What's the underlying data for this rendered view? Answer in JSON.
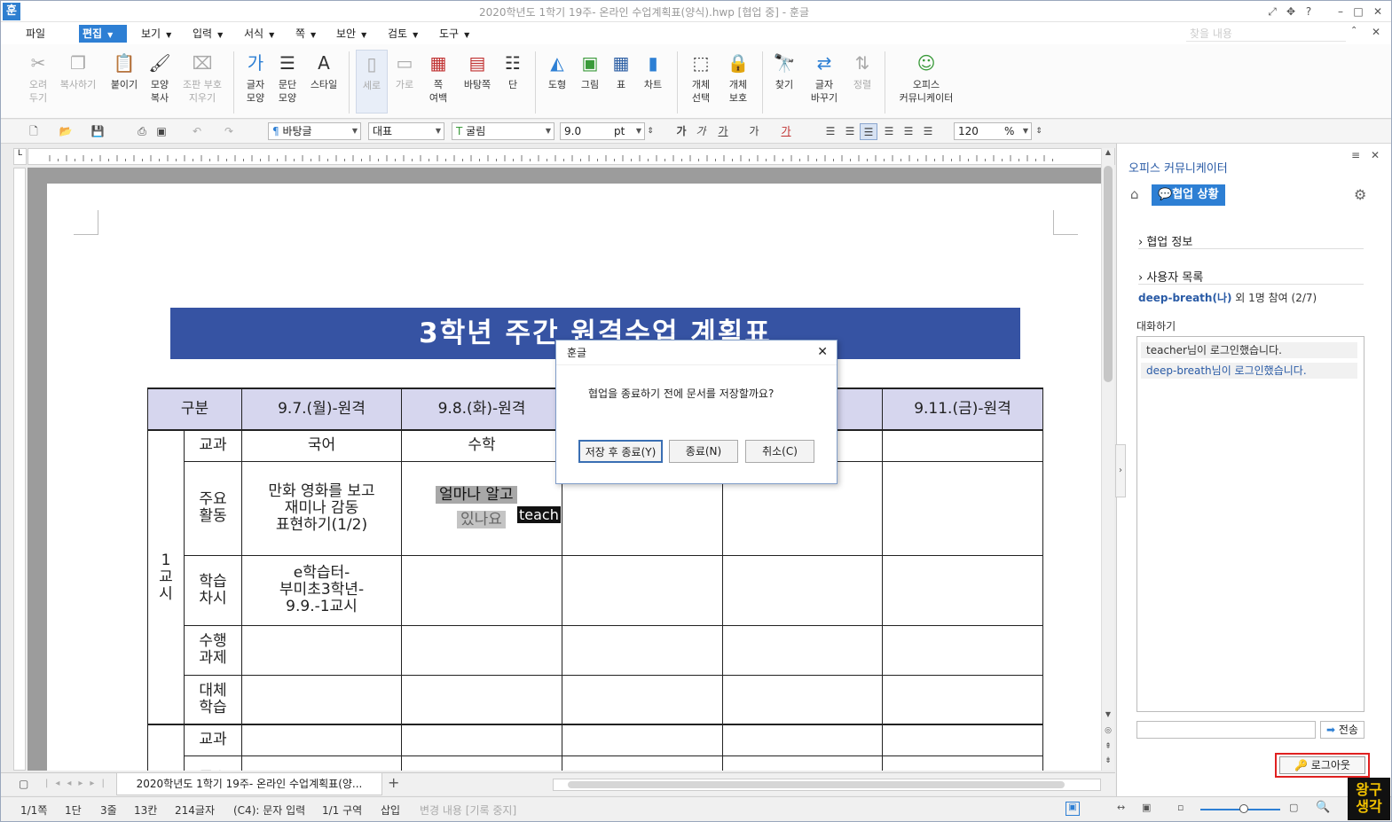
{
  "window": {
    "title": "2020학년도 1학기 19주- 온라인 수업계획표(양식).hwp [협업 중] - 훈글",
    "logo": "훈"
  },
  "menu": [
    "파일",
    "편집",
    "보기",
    "입력",
    "서식",
    "쪽",
    "보안",
    "검토",
    "도구"
  ],
  "search_placeholder": "찾을 내용",
  "ribbon": [
    {
      "label": "오려\n두기",
      "icon": "scissors-icon",
      "disabled": true
    },
    {
      "label": "복사하기",
      "icon": "copy-icon",
      "disabled": true
    },
    {
      "label": "붙이기",
      "icon": "paste-icon",
      "disabled": false
    },
    {
      "label": "모양\n복사",
      "icon": "format-painter-icon",
      "disabled": false
    },
    {
      "label": "조판 부호\n지우기",
      "icon": "clear-codes-icon",
      "disabled": true
    },
    {
      "label": "글자\n모양",
      "icon": "char-shape-icon",
      "disabled": false
    },
    {
      "label": "문단\n모양",
      "icon": "para-shape-icon",
      "disabled": false
    },
    {
      "label": "스타일",
      "icon": "style-icon",
      "disabled": false
    },
    {
      "label": "세로",
      "icon": "portrait-icon",
      "disabled": true
    },
    {
      "label": "가로",
      "icon": "landscape-icon",
      "disabled": true
    },
    {
      "label": "쪽\n여백",
      "icon": "margin-icon",
      "disabled": false
    },
    {
      "label": "바탕쪽",
      "icon": "master-page-icon",
      "disabled": false
    },
    {
      "label": "단",
      "icon": "column-icon",
      "disabled": false
    },
    {
      "label": "도형",
      "icon": "shape-icon",
      "disabled": false
    },
    {
      "label": "그림",
      "icon": "picture-icon",
      "disabled": false
    },
    {
      "label": "표",
      "icon": "table-icon",
      "disabled": false
    },
    {
      "label": "차트",
      "icon": "chart-icon",
      "disabled": false
    },
    {
      "label": "개체\n선택",
      "icon": "select-object-icon",
      "disabled": false
    },
    {
      "label": "개체\n보호",
      "icon": "protect-object-icon",
      "disabled": false
    },
    {
      "label": "찾기",
      "icon": "find-icon",
      "disabled": false
    },
    {
      "label": "글자\n바꾸기",
      "icon": "replace-icon",
      "disabled": false
    },
    {
      "label": "정렬",
      "icon": "sort-icon",
      "disabled": true
    },
    {
      "label": "오피스\n커뮤니케이터",
      "icon": "communicator-icon",
      "disabled": false
    }
  ],
  "toolbar": {
    "style": "바탕글",
    "lang": "대표",
    "font": "굴림",
    "size": "9.0",
    "unit": "pt",
    "zoom": "120",
    "zoom_unit": "%"
  },
  "document": {
    "banner": "3학년 주간 원격수업 계획표",
    "headers": [
      "구분",
      "9.7.(월)-원격",
      "9.8.(화)-원격",
      "9.11.(금)-원격"
    ],
    "period1": "1\n교\n시",
    "rows": [
      "교과",
      "주요\n활동",
      "학습\n차시",
      "수행\n과제",
      "대체\n학습"
    ],
    "mon_subject": "국어",
    "tue_subject": "수학",
    "mon_activity": "만화 영화를 보고\n재미나 감동\n표현하기(1/2)",
    "tue_activity_1": "얼마나 알고",
    "tue_activity_2": "있나요",
    "cursor_tag": "teach",
    "mon_lesson": "e학습터-\n부미초3학년-\n9.9.-1교시",
    "row2": [
      "교과",
      "주요"
    ]
  },
  "dialog": {
    "title": "훈글",
    "message": "협업을 종료하기 전에 문서를 저장할까요?",
    "buttons": [
      "저장 후 종료(Y)",
      "종료(N)",
      "취소(C)"
    ]
  },
  "doc_tab": "2020학년도 1학기 19주- 온라인 수업계획표(양...",
  "status": [
    "1/1쪽",
    "1단",
    "3줄",
    "13칸",
    "214글자",
    "(C4): 문자 입력",
    "1/1 구역",
    "삽입",
    "변경 내용 [기록 중지]"
  ],
  "panel": {
    "title": "오피스 커뮤니케이터",
    "status_tab": "협업 상황",
    "collab_info": "협업 정보",
    "user_list": "사용자 목록",
    "user_name": "deep-breath(나)",
    "user_rest": " 외 1명 참여 (2/7)",
    "chat_label": "대화하기",
    "messages": [
      "teacher님이 로그인했습니다.",
      "deep-breath님이 로그인했습니다."
    ],
    "send": "전송",
    "logout": "로그아웃"
  },
  "watermark": "왕구\n생각",
  "colors": {
    "accent": "#2d7fd4",
    "banner": "#3653a3",
    "table_header": "#d6d6ee",
    "logout_highlight": "#e02020"
  }
}
